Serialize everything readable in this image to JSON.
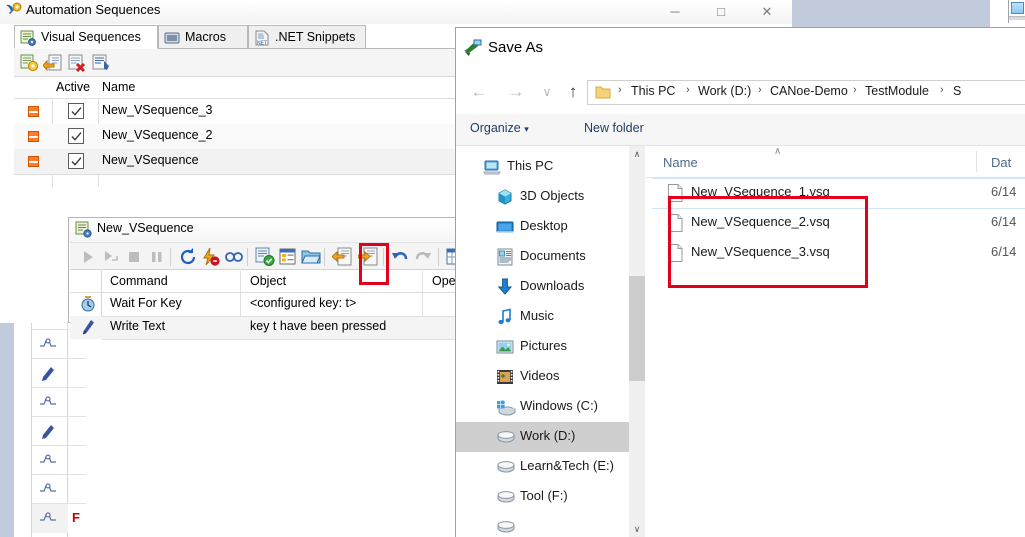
{
  "background": {
    "note": "partially visible windows behind"
  },
  "automation_window": {
    "title": "Automation Sequences",
    "title_icon": "automation-sequences-icon",
    "window_buttons": {
      "minimize": "─",
      "maximize": "□",
      "close": "✕"
    },
    "tabs": [
      {
        "label": "Visual Sequences",
        "icon": "visual-sequences-icon",
        "active": true
      },
      {
        "label": "Macros",
        "icon": "macros-icon",
        "active": false
      },
      {
        "label": ".NET Snippets",
        "icon": "net-snippets-icon",
        "active": false
      }
    ],
    "toolbar": [
      {
        "name": "new-sequence-icon"
      },
      {
        "name": "import-sequence-icon"
      },
      {
        "name": "delete-sequence-icon"
      },
      {
        "name": "edit-sequence-icon"
      }
    ],
    "grid": {
      "columns": [
        "Active",
        "Name"
      ],
      "rows": [
        {
          "name": "New_VSequence_3",
          "active": true,
          "status": "stopped"
        },
        {
          "name": "New_VSequence_2",
          "active": true,
          "status": "stopped"
        },
        {
          "name": "New_VSequence",
          "active": true,
          "status": "stopped"
        }
      ]
    }
  },
  "vsequence_window": {
    "title": "New_VSequence",
    "title_icon": "visual-sequence-icon",
    "toolbar": [
      {
        "name": "start-icon"
      },
      {
        "name": "step-icon"
      },
      {
        "name": "stop-icon"
      },
      {
        "name": "pause-icon"
      },
      {
        "name": "reset-icon"
      },
      {
        "name": "debug-icon"
      },
      {
        "name": "loop-icon"
      },
      {
        "name": "validate-icon"
      },
      {
        "name": "properties-icon"
      },
      {
        "name": "open-folder-icon"
      },
      {
        "name": "import-icon"
      },
      {
        "name": "export-icon"
      },
      {
        "name": "undo-icon"
      },
      {
        "name": "redo-icon"
      },
      {
        "name": "grid-icon"
      }
    ],
    "highlighted_toolbar_button": "export-icon",
    "grid": {
      "columns": [
        "Command",
        "Object",
        "Ope"
      ],
      "rows": [
        {
          "icon": "wait-clock-icon",
          "command": "Wait For Key",
          "object": "<configured key: t>"
        },
        {
          "icon": "write-pen-icon",
          "command": "Write Text",
          "object": "key t have been pressed",
          "selected": true
        },
        {
          "icon": "",
          "command": "",
          "object": ""
        }
      ]
    }
  },
  "save_as_dialog": {
    "title": "Save As",
    "title_icon": "save-as-icon",
    "nav_buttons": {
      "back": "←",
      "forward": "→",
      "recent": "∨",
      "up": "↑"
    },
    "breadcrumb": {
      "folder_icon": "folder-icon",
      "separator": "›",
      "items": [
        "This PC",
        "Work (D:)",
        "CANoe-Demo",
        "TestModule",
        "S"
      ]
    },
    "command_bar": [
      {
        "label": "Organize",
        "has_dropdown": true,
        "caret": "▾"
      },
      {
        "label": "New folder",
        "has_dropdown": false
      }
    ],
    "nav_pane": {
      "items": [
        {
          "label": "This PC",
          "icon": "this-pc-icon",
          "selected": false,
          "indent": 0
        },
        {
          "label": "3D Objects",
          "icon": "3d-objects-icon",
          "selected": false,
          "indent": 1
        },
        {
          "label": "Desktop",
          "icon": "desktop-icon",
          "selected": false,
          "indent": 1
        },
        {
          "label": "Documents",
          "icon": "documents-icon",
          "selected": false,
          "indent": 1
        },
        {
          "label": "Downloads",
          "icon": "downloads-icon",
          "selected": false,
          "indent": 1
        },
        {
          "label": "Music",
          "icon": "music-icon",
          "selected": false,
          "indent": 1
        },
        {
          "label": "Pictures",
          "icon": "pictures-icon",
          "selected": false,
          "indent": 1
        },
        {
          "label": "Videos",
          "icon": "videos-icon",
          "selected": false,
          "indent": 1
        },
        {
          "label": "Windows (C:)",
          "icon": "windows-drive-icon",
          "selected": false,
          "indent": 1
        },
        {
          "label": "Work (D:)",
          "icon": "drive-icon",
          "selected": true,
          "indent": 1
        },
        {
          "label": "Learn&Tech (E:)",
          "icon": "drive-icon",
          "selected": false,
          "indent": 1
        },
        {
          "label": "Tool (F:)",
          "icon": "drive-icon",
          "selected": false,
          "indent": 1
        }
      ],
      "scrollbar": {
        "up_arrow": "∧",
        "down_arrow": "∨"
      }
    },
    "file_list": {
      "columns": [
        "Name",
        "Dat"
      ],
      "sort_indicator": "∧",
      "rows": [
        {
          "name": "New_VSequence_1.vsq",
          "date": "6/14",
          "icon": "file-icon"
        },
        {
          "name": "New_VSequence_2.vsq",
          "date": "6/14",
          "icon": "file-icon"
        },
        {
          "name": "New_VSequence_3.vsq",
          "date": "6/14",
          "icon": "file-icon"
        }
      ]
    }
  },
  "annotations": {
    "highlight_color": "#e2001a",
    "boxes": [
      "toolbar-export-button",
      "file-list-vsq-files"
    ]
  }
}
